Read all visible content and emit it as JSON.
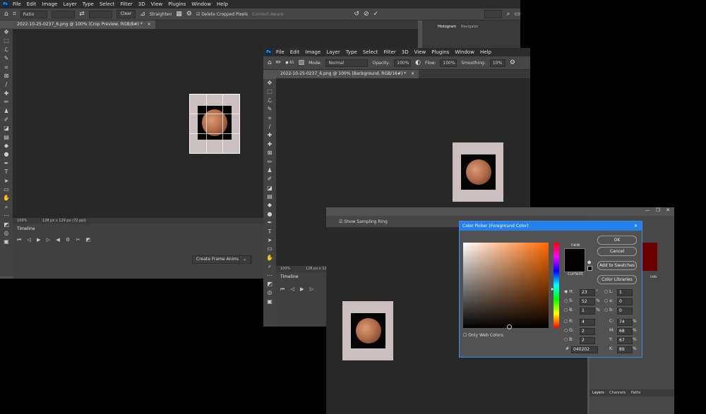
{
  "menu": [
    "File",
    "Edit",
    "Image",
    "Layer",
    "Type",
    "Select",
    "Filter",
    "3D",
    "View",
    "Plugins",
    "Window",
    "Help"
  ],
  "app_logo": "Ps",
  "win1": {
    "options": {
      "ratio_label": "Ratio",
      "clear_label": "Clear",
      "straighten_label": "Straighten",
      "delete_cropped_label": "Delete Cropped Pixels",
      "content_aware_label": "Content-Aware"
    },
    "tab_title": "2022-10-25-0237_6.png @ 100% (Crop Preview, RGB/8#) *",
    "zoom": "100%",
    "doc_size": "128 px x 129 px (72 ppi)",
    "timeline_title": "Timeline",
    "create_frame_animation": "Create Frame Animation",
    "panel_tabs": [
      "Histogram",
      "Navigator"
    ]
  },
  "win2": {
    "options": {
      "mode_label": "Mode:",
      "mode_value": "Normal",
      "opacity_label": "Opacity:",
      "opacity_value": "100%",
      "flow_label": "Flow:",
      "flow_value": "100%",
      "smoothing_label": "Smoothing:",
      "smoothing_value": "10%",
      "brush_size": "61"
    },
    "tab_title": "2022-10-25-0237_6.png @ 100% (Background, RGB/16#) *",
    "zoom": "100%",
    "doc_size": "128 px x 129 px",
    "timeline_title": "Timeline"
  },
  "win3": {
    "show_sampling_ring": "Show Sampling Ring",
    "layers_tabs": [
      "Layers",
      "Channels",
      "Paths"
    ],
    "info_tab": "Info"
  },
  "color_picker": {
    "title": "Color Picker (Foreground Color)",
    "ok": "OK",
    "cancel": "Cancel",
    "add_to_swatches": "Add to Swatches",
    "color_libraries": "Color Libraries",
    "new_label": "new",
    "current_label": "current",
    "only_web_colors": "Only Web Colors",
    "hsb": {
      "H": "23",
      "S": "52",
      "B": "1",
      "H_unit": "°",
      "S_unit": "%",
      "B_unit": "%"
    },
    "rgb": {
      "R": "4",
      "G": "2",
      "B": "2"
    },
    "lab": {
      "L": "1",
      "a": "0",
      "b": "0"
    },
    "cmyk": {
      "C": "74",
      "M": "68",
      "Y": "67",
      "K": "89",
      "unit": "%"
    },
    "hex": "040202",
    "new_color": "#040202",
    "hue_color": "#ff6a00"
  }
}
